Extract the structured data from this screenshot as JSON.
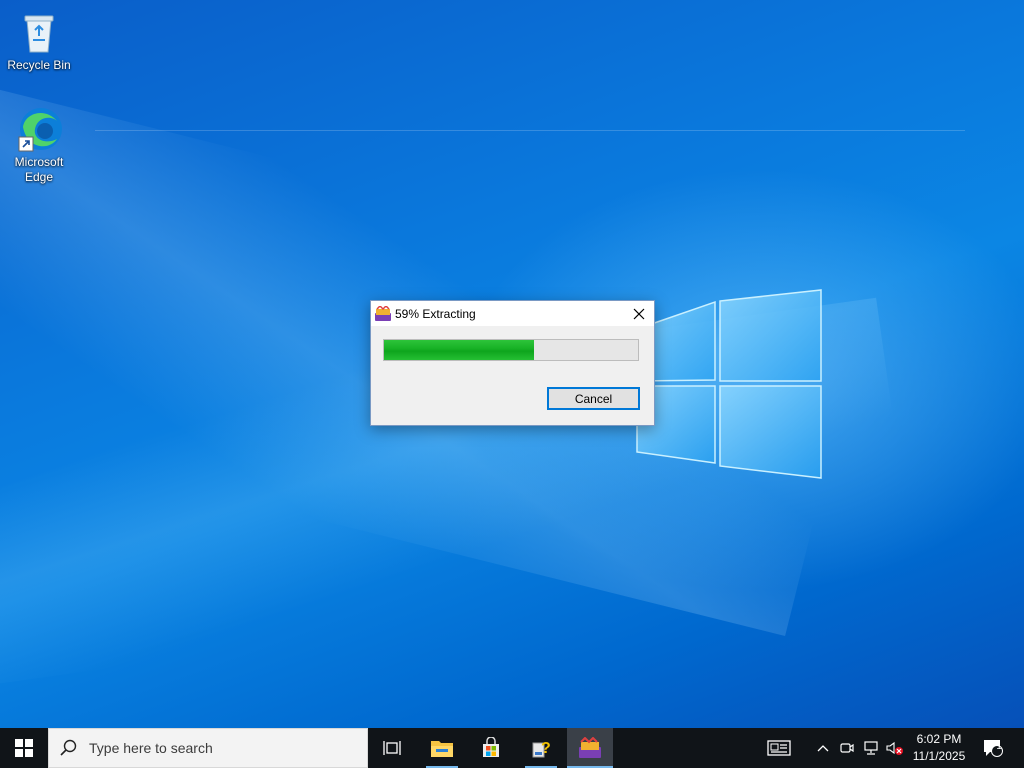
{
  "desktop": {
    "icons": [
      {
        "label": "Recycle Bin",
        "icon": "recycle-bin-icon"
      },
      {
        "label": "Microsoft\nEdge",
        "icon": "edge-icon"
      }
    ]
  },
  "dialog": {
    "title": "59% Extracting",
    "progress_percent": 59,
    "cancel_label": "Cancel",
    "icons": {
      "app": "archive-app-icon",
      "close": "close-icon"
    }
  },
  "taskbar": {
    "search_placeholder": "Type here to search",
    "pinned": [
      "start-icon",
      "task-view-icon",
      "file-explorer-icon",
      "store-icon",
      "help-app-icon",
      "archive-app-icon"
    ],
    "tray_icons": [
      "news-icon",
      "chevron-up-icon",
      "meet-now-icon",
      "network-icon",
      "volume-muted-icon",
      "notifications-icon"
    ],
    "clock": {
      "time": "6:02 PM",
      "date": "11/1/2025"
    },
    "notification_count": "1"
  },
  "colors": {
    "accent": "#0078d7",
    "progress_green": "#16b024",
    "taskbar_bg": "#101418"
  }
}
